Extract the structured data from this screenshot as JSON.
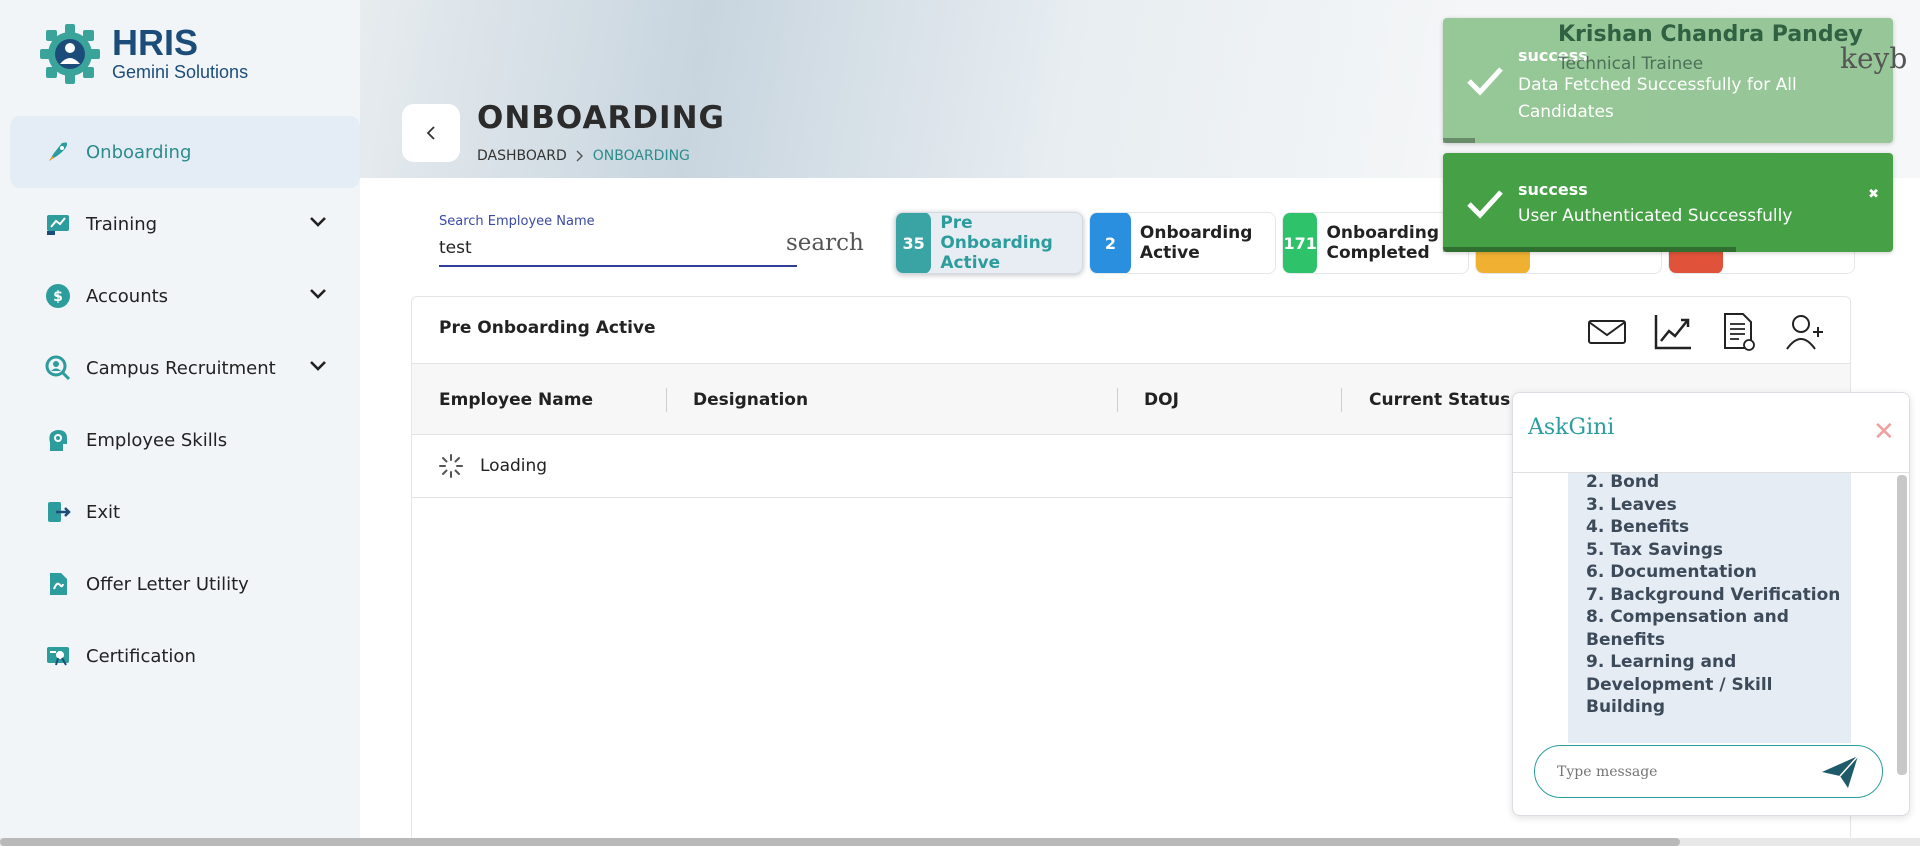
{
  "app": {
    "logo_title": "HRIS",
    "logo_subtitle": "Gemini Solutions"
  },
  "sidebar": {
    "items": [
      {
        "label": "Onboarding",
        "icon": "rocket-icon",
        "active": true,
        "expandable": false
      },
      {
        "label": "Training",
        "icon": "training-icon",
        "active": false,
        "expandable": true
      },
      {
        "label": "Accounts",
        "icon": "dollar-icon",
        "active": false,
        "expandable": true
      },
      {
        "label": "Campus Recruitment",
        "icon": "campus-search-icon",
        "active": false,
        "expandable": true
      },
      {
        "label": "Employee Skills",
        "icon": "skills-head-icon",
        "active": false,
        "expandable": false
      },
      {
        "label": "Exit",
        "icon": "exit-icon",
        "active": false,
        "expandable": false
      },
      {
        "label": "Offer Letter Utility",
        "icon": "offer-letter-icon",
        "active": false,
        "expandable": false
      },
      {
        "label": "Certification",
        "icon": "certificate-icon",
        "active": false,
        "expandable": false
      }
    ]
  },
  "header": {
    "title": "ONBOARDING",
    "breadcrumb": [
      "DASHBOARD",
      "ONBOARDING"
    ]
  },
  "search": {
    "label": "Search Employee Name",
    "value": "test",
    "icon_text": "search"
  },
  "stats": [
    {
      "count": "35",
      "label": "Pre Onboarding Active",
      "color": "#3aa3a3",
      "active": true
    },
    {
      "count": "2",
      "label": "Onboarding Active",
      "color": "#2b8fe0",
      "active": false
    },
    {
      "count": "171",
      "label": "Onboarding Completed",
      "color": "#2ec26b",
      "active": false
    },
    {
      "count": "",
      "label": "",
      "color": "#f0b133",
      "active": false
    },
    {
      "count": "",
      "label": "",
      "color": "#e0533a",
      "active": false
    }
  ],
  "table": {
    "title": "Pre Onboarding Active",
    "columns": [
      "Employee Name",
      "Designation",
      "DOJ",
      "Current Status"
    ],
    "loading_text": "Loading",
    "actions": [
      "mail-icon",
      "trend-chart-icon",
      "document-icon",
      "add-user-icon"
    ]
  },
  "user": {
    "name": "Krishan Chandra Pandey",
    "role": "Technical Trainee"
  },
  "keyboard_text": "keyb",
  "toasts": [
    {
      "title": "success",
      "message": "Data Fetched Successfully for All Candidates",
      "progress": 0.07
    },
    {
      "title": "success",
      "message": "User Authenticated Successfully",
      "progress": 0.65,
      "close": "✖"
    }
  ],
  "chat": {
    "title": "AskGini",
    "close": "✕",
    "items": [
      "2.  Bond",
      "3.  Leaves",
      "4.  Benefits",
      "5.  Tax Savings",
      "6.  Documentation",
      "7.  Background Verification",
      "8.  Compensation and Benefits",
      "9.  Learning and Development / Skill Building"
    ],
    "input_placeholder": "Type message"
  },
  "colors": {
    "accent": "#2c9c9c",
    "brand": "#1c4d7a",
    "toast_green": "#46a046"
  }
}
